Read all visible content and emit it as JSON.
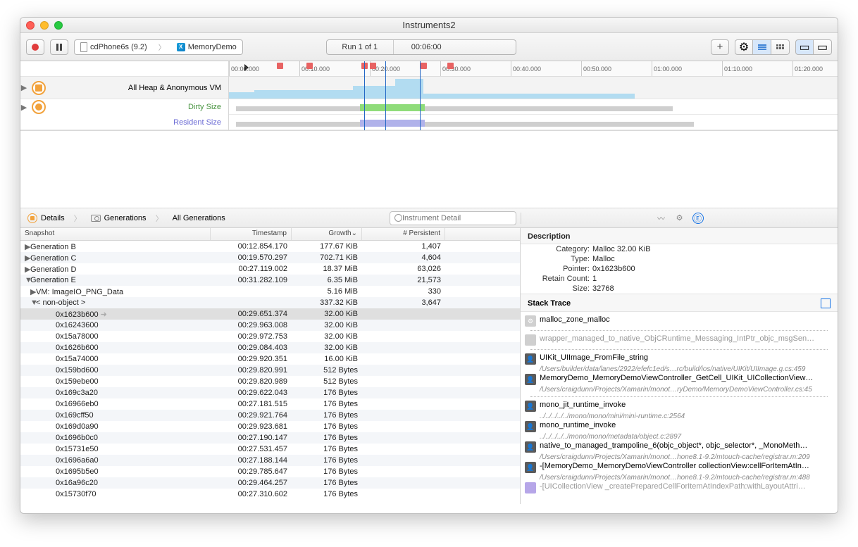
{
  "window": {
    "title": "Instruments2"
  },
  "toolbar": {
    "device": "cdPhone6s (9.2)",
    "app": "MemoryDemo",
    "run_status": "Run 1 of 1",
    "elapsed": "00:06:00",
    "search_placeholder": "Instrument Detail"
  },
  "tracks": {
    "main": "All Heap & Anonymous VM",
    "dirty": "Dirty Size",
    "resident": "Resident Size"
  },
  "ruler": [
    "00:00.000",
    "00:10.000",
    "00:20.000",
    "00:30.000",
    "00:40.000",
    "00:50.000",
    "01:00.000",
    "01:10.000",
    "01:20.000"
  ],
  "breadcrumb": {
    "details": "Details",
    "generations": "Generations",
    "all": "All Generations"
  },
  "columns": {
    "snapshot": "Snapshot",
    "timestamp": "Timestamp",
    "growth": "Growth⌄",
    "persistent": "# Persistent"
  },
  "rows": [
    {
      "d": "▶",
      "ind": 0,
      "name": "Generation B",
      "ts": "00:12.854.170",
      "g": "177.67 KiB",
      "p": "1,407"
    },
    {
      "d": "▶",
      "ind": 0,
      "name": "Generation C",
      "ts": "00:19.570.297",
      "g": "702.71 KiB",
      "p": "4,604"
    },
    {
      "d": "▶",
      "ind": 0,
      "name": "Generation D",
      "ts": "00:27.119.002",
      "g": "18.37 MiB",
      "p": "63,026"
    },
    {
      "d": "▼",
      "ind": 0,
      "name": "Generation E",
      "ts": "00:31.282.109",
      "g": "6.35 MiB",
      "p": "21,573"
    },
    {
      "d": "▶",
      "ind": 1,
      "name": "VM: ImageIO_PNG_Data",
      "ts": "",
      "g": "5.16 MiB",
      "p": "330"
    },
    {
      "d": "▼",
      "ind": 1,
      "name": "< non-object >",
      "ts": "",
      "g": "337.32 KiB",
      "p": "3,647"
    },
    {
      "d": "",
      "ind": 2,
      "name": "0x1623b600",
      "ts": "00:29.651.374",
      "g": "32.00 KiB",
      "p": "",
      "sel": true
    },
    {
      "d": "",
      "ind": 2,
      "name": "0x16243600",
      "ts": "00:29.963.008",
      "g": "32.00 KiB",
      "p": ""
    },
    {
      "d": "",
      "ind": 2,
      "name": "0x15a78000",
      "ts": "00:29.972.753",
      "g": "32.00 KiB",
      "p": ""
    },
    {
      "d": "",
      "ind": 2,
      "name": "0x1626b600",
      "ts": "00:29.084.403",
      "g": "32.00 KiB",
      "p": ""
    },
    {
      "d": "",
      "ind": 2,
      "name": "0x15a74000",
      "ts": "00:29.920.351",
      "g": "16.00 KiB",
      "p": ""
    },
    {
      "d": "",
      "ind": 2,
      "name": "0x159bd600",
      "ts": "00:29.820.991",
      "g": "512 Bytes",
      "p": ""
    },
    {
      "d": "",
      "ind": 2,
      "name": "0x159ebe00",
      "ts": "00:29.820.989",
      "g": "512 Bytes",
      "p": ""
    },
    {
      "d": "",
      "ind": 2,
      "name": "0x169c3a20",
      "ts": "00:29.622.043",
      "g": "176 Bytes",
      "p": ""
    },
    {
      "d": "",
      "ind": 2,
      "name": "0x16966eb0",
      "ts": "00:27.181.515",
      "g": "176 Bytes",
      "p": ""
    },
    {
      "d": "",
      "ind": 2,
      "name": "0x169cff50",
      "ts": "00:29.921.764",
      "g": "176 Bytes",
      "p": ""
    },
    {
      "d": "",
      "ind": 2,
      "name": "0x169d0a90",
      "ts": "00:29.923.681",
      "g": "176 Bytes",
      "p": ""
    },
    {
      "d": "",
      "ind": 2,
      "name": "0x1696b0c0",
      "ts": "00:27.190.147",
      "g": "176 Bytes",
      "p": ""
    },
    {
      "d": "",
      "ind": 2,
      "name": "0x15731e50",
      "ts": "00:27.531.457",
      "g": "176 Bytes",
      "p": ""
    },
    {
      "d": "",
      "ind": 2,
      "name": "0x1696a6a0",
      "ts": "00:27.188.144",
      "g": "176 Bytes",
      "p": ""
    },
    {
      "d": "",
      "ind": 2,
      "name": "0x1695b5e0",
      "ts": "00:29.785.647",
      "g": "176 Bytes",
      "p": ""
    },
    {
      "d": "",
      "ind": 2,
      "name": "0x16a96c20",
      "ts": "00:29.464.257",
      "g": "176 Bytes",
      "p": ""
    },
    {
      "d": "",
      "ind": 2,
      "name": "0x15730f70",
      "ts": "00:27.310.602",
      "g": "176 Bytes",
      "p": ""
    }
  ],
  "description": {
    "title": "Description",
    "category_k": "Category:",
    "category_v": "Malloc 32.00 KiB",
    "type_k": "Type:",
    "type_v": "Malloc",
    "pointer_k": "Pointer:",
    "pointer_v": "0x1623b600",
    "retain_k": "Retain Count:",
    "retain_v": "1",
    "size_k": "Size:",
    "size_v": "32768"
  },
  "stack": {
    "title": "Stack Trace",
    "items": [
      {
        "ico": "gear",
        "t": "malloc_zone_malloc",
        "sub": ""
      },
      {
        "ico": "sep"
      },
      {
        "ico": "gray",
        "t": "wrapper_managed_to_native_ObjCRuntime_Messaging_IntPtr_objc_msgSen…",
        "gray": true
      },
      {
        "ico": "sep"
      },
      {
        "ico": "sys",
        "t": "UIKit_UIImage_FromFile_string",
        "sub": "/Users/builder/data/lanes/2922/efefc1ed/s…rc/build/ios/native/UIKit/UIImage.g.cs:459"
      },
      {
        "ico": "sys",
        "t": "MemoryDemo_MemoryDemoViewController_GetCell_UIKit_UICollectionView…",
        "sub": "/Users/craigdunn/Projects/Xamarin/monot…ryDemo/MemoryDemoViewController.cs:45"
      },
      {
        "ico": "sep"
      },
      {
        "ico": "sys",
        "t": "mono_jit_runtime_invoke",
        "sub": "../../../../../mono/mono/mini/mini-runtime.c:2564"
      },
      {
        "ico": "sys",
        "t": "mono_runtime_invoke",
        "sub": "../../../../../mono/mono/metadata/object.c:2897"
      },
      {
        "ico": "sys",
        "t": "native_to_managed_trampoline_6(objc_object*, objc_selector*, _MonoMeth…",
        "sub": "/Users/craigdunn/Projects/Xamarin/monot…hone8.1-9.2/mtouch-cache/registrar.m:209"
      },
      {
        "ico": "sys",
        "t": "-[MemoryDemo_MemoryDemoViewController collectionView:cellForItemAtIn…",
        "sub": "/Users/craigdunn/Projects/Xamarin/monot…hone8.1-9.2/mtouch-cache/registrar.m:488"
      },
      {
        "ico": "purple",
        "t": "-[UICollectionView _createPreparedCellForItemAtIndexPath:withLayoutAttri…",
        "gray": true
      }
    ]
  }
}
